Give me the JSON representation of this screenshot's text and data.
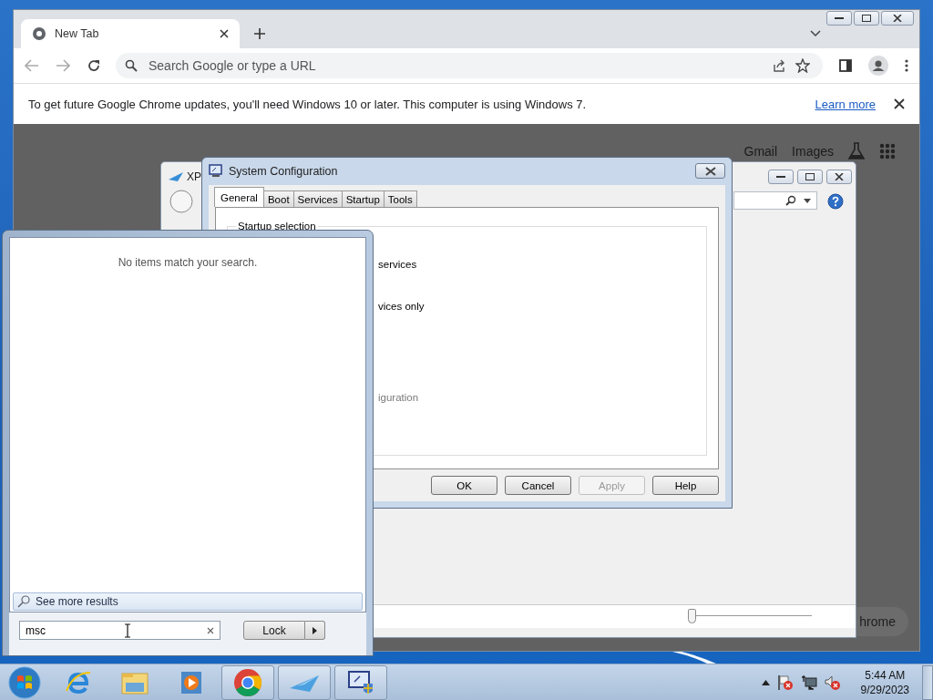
{
  "browser": {
    "tabs": [
      {
        "title": "New Tab",
        "selected": true
      }
    ],
    "omnibox": {
      "placeholder": "Search Google or type a URL"
    },
    "infobar": {
      "message": "To get future Google Chrome updates, you'll need Windows 10 or later. This computer is using Windows 7.",
      "link": "Learn more"
    },
    "page": {
      "links": [
        "Gmail",
        "Images"
      ],
      "customize_button": "hrome"
    }
  },
  "background_window": {
    "title": "XP",
    "slider": {
      "level": 0.0
    }
  },
  "dialog": {
    "title": "System Configuration",
    "tabs": [
      {
        "label": "General",
        "selected": true
      },
      {
        "label": "Boot",
        "selected": false
      },
      {
        "label": "Services",
        "selected": false
      },
      {
        "label": "Startup",
        "selected": false
      },
      {
        "label": "Tools",
        "selected": false
      }
    ],
    "group_label": "Startup selection",
    "options": [
      {
        "label": "services",
        "disabled": false
      },
      {
        "label": "vices only",
        "disabled": false
      },
      {
        "label": "iguration",
        "disabled": true
      }
    ],
    "buttons": [
      {
        "label": "OK",
        "disabled": false
      },
      {
        "label": "Cancel",
        "disabled": false
      },
      {
        "label": "Apply",
        "disabled": true
      },
      {
        "label": "Help",
        "disabled": false
      }
    ]
  },
  "start_menu": {
    "message": "No items match your search.",
    "see_more": "See more results",
    "search": {
      "value": "msc"
    },
    "power_button": "Lock"
  },
  "taskbar": {
    "items": [
      {
        "kind": "ie",
        "running": false
      },
      {
        "kind": "explorer",
        "running": false
      },
      {
        "kind": "media",
        "running": false
      },
      {
        "kind": "chrome",
        "running": true
      },
      {
        "kind": "xpapp",
        "running": true
      },
      {
        "kind": "msconfig",
        "running": true
      }
    ],
    "clock": {
      "time": "5:44 AM",
      "date": "9/29/2023"
    }
  }
}
